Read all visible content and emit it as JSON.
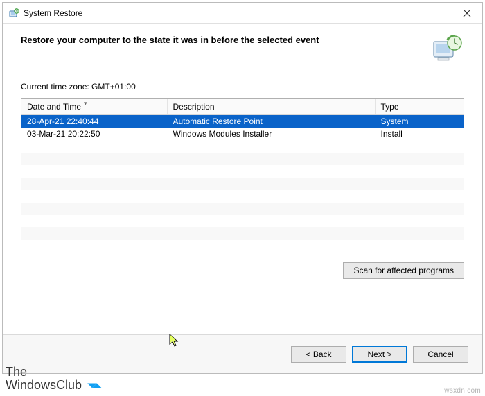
{
  "titlebar": {
    "title": "System Restore"
  },
  "header": {
    "heading": "Restore your computer to the state it was in before the selected event"
  },
  "timezone_label": "Current time zone: GMT+01:00",
  "table": {
    "cols": {
      "date": "Date and Time",
      "desc": "Description",
      "type": "Type"
    },
    "rows": [
      {
        "date": "28-Apr-21 22:40:44",
        "desc": "Automatic Restore Point",
        "type": "System",
        "selected": true
      },
      {
        "date": "03-Mar-21 20:22:50",
        "desc": "Windows Modules Installer",
        "type": "Install",
        "selected": false
      }
    ]
  },
  "buttons": {
    "scan": "Scan for affected programs",
    "back": "< Back",
    "next": "Next >",
    "cancel": "Cancel"
  },
  "watermark": {
    "line1": "The",
    "line2": "WindowsClub"
  },
  "source": "wsxdn.com"
}
